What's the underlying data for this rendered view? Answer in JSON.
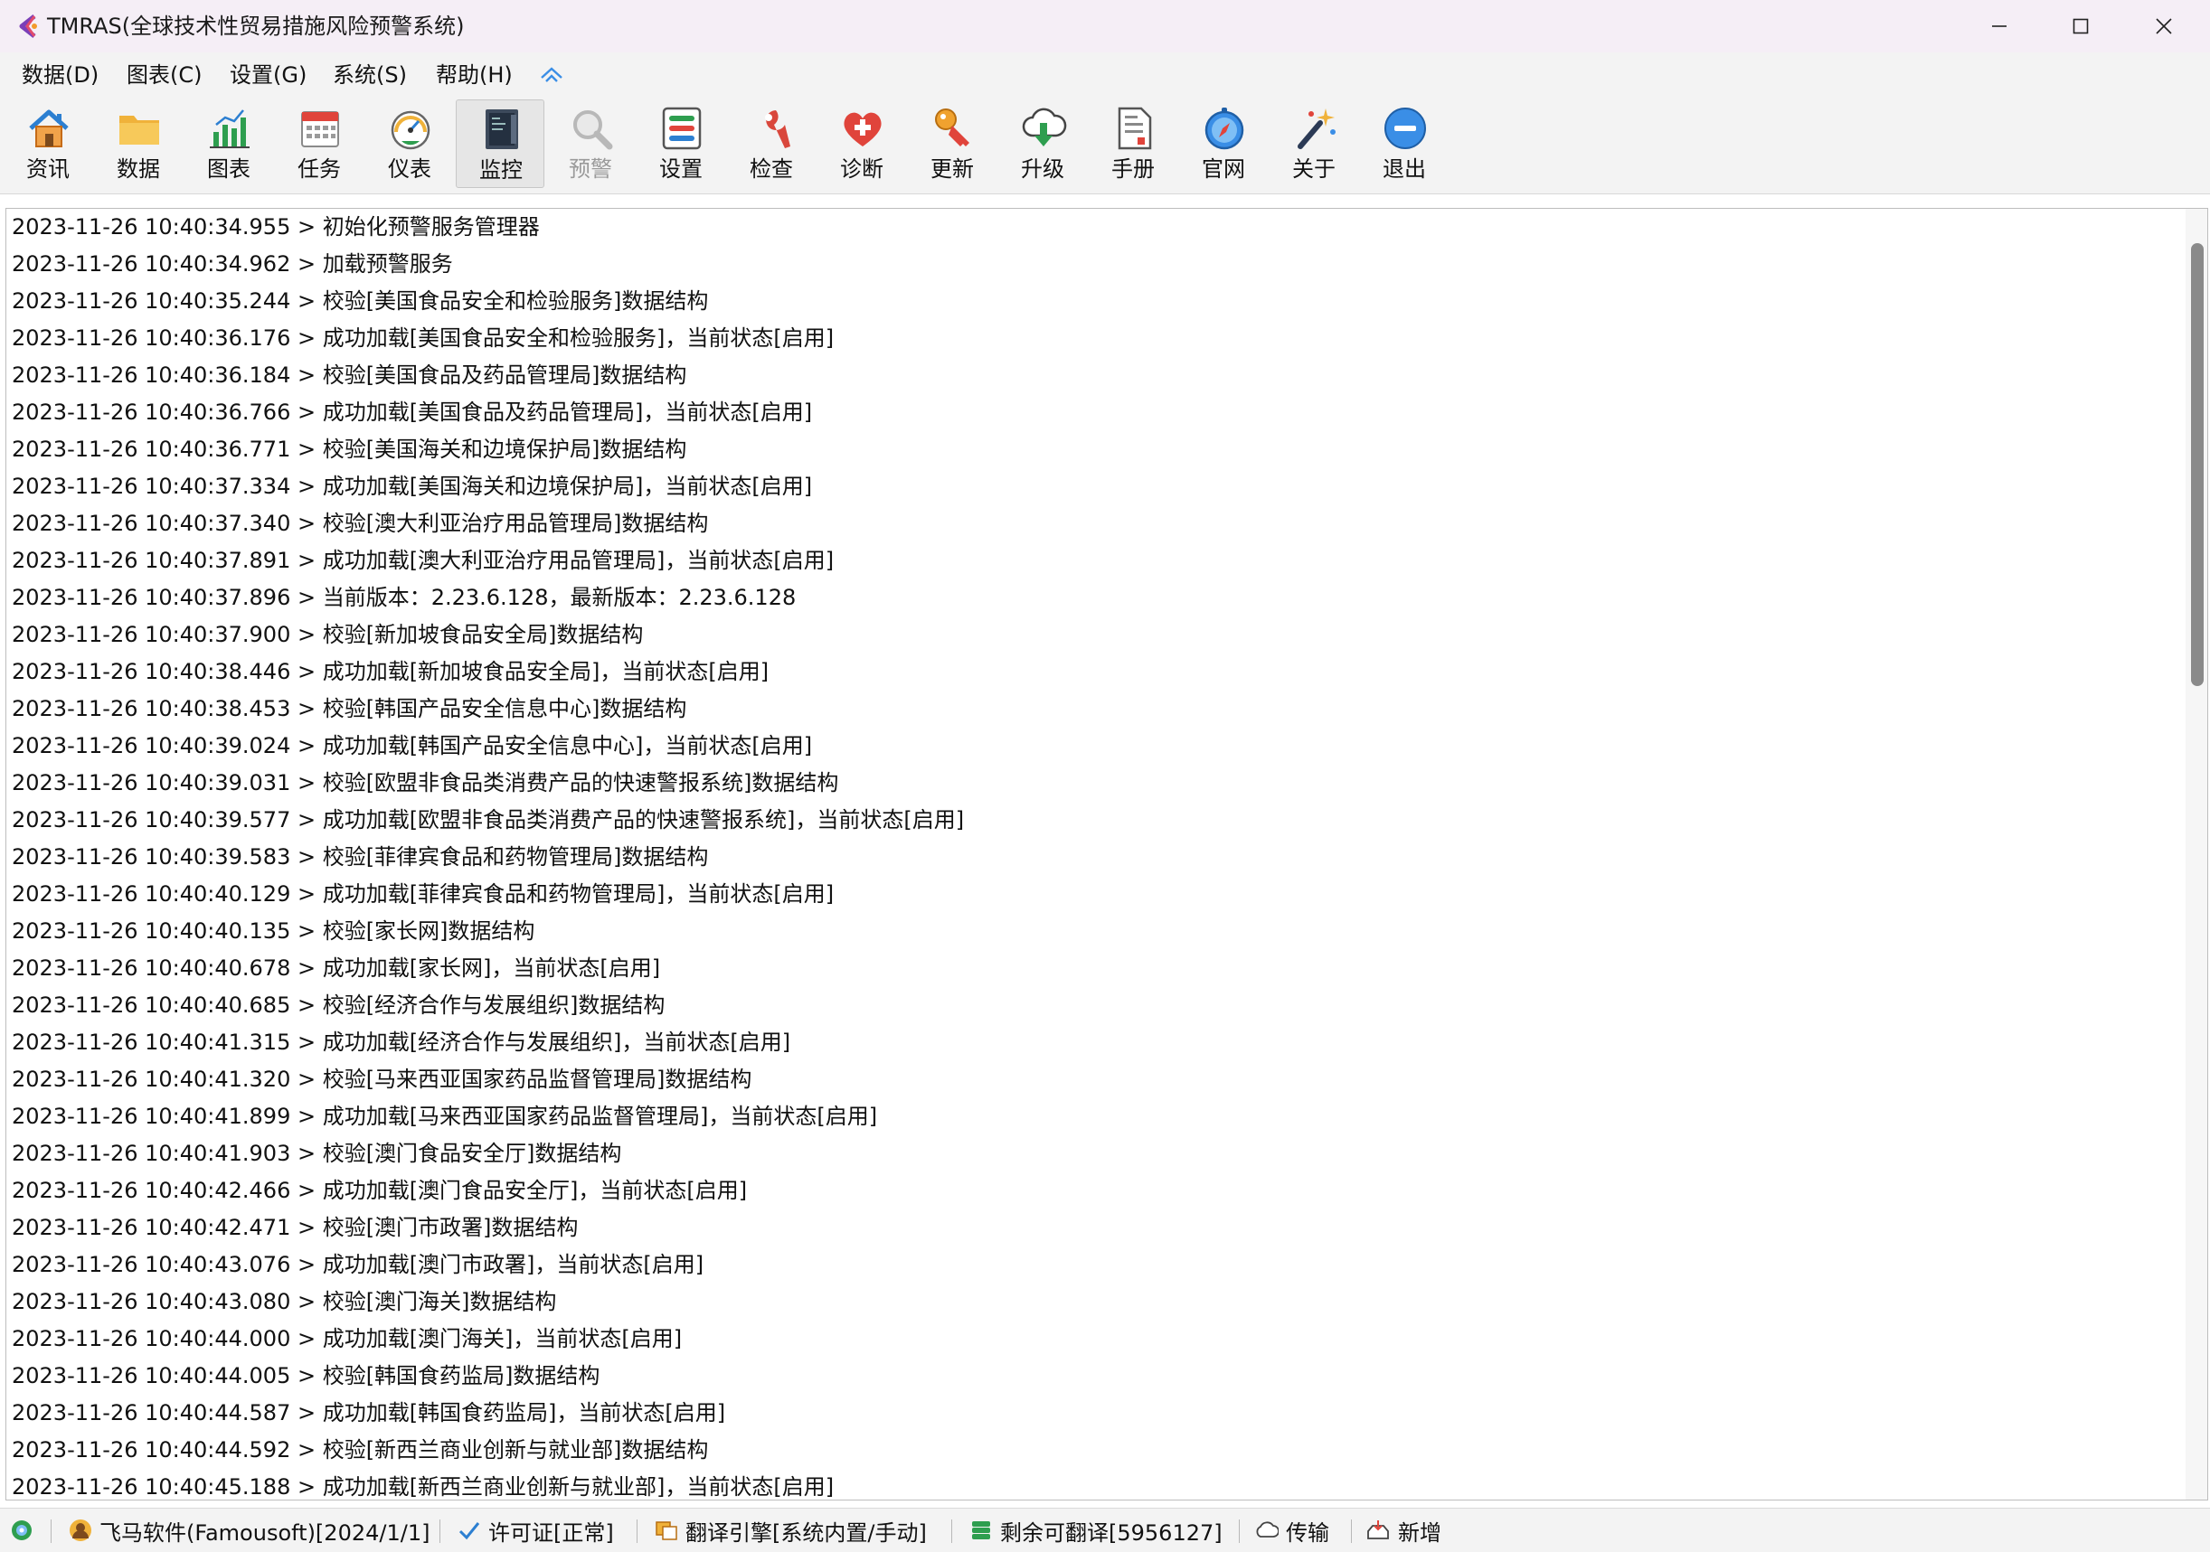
{
  "window": {
    "title": "TMRAS(全球技术性贸易措施风险预警系统)",
    "controls": {
      "minimize": "minimize",
      "maximize": "maximize",
      "close": "close"
    }
  },
  "menu": {
    "items": [
      {
        "label": "数据(D)"
      },
      {
        "label": "图表(C)"
      },
      {
        "label": "设置(G)"
      },
      {
        "label": "系统(S)"
      },
      {
        "label": "帮助(H)"
      }
    ]
  },
  "toolbar": {
    "buttons": [
      {
        "label": "资讯",
        "icon": "home-icon",
        "state": "normal"
      },
      {
        "label": "数据",
        "icon": "folder-icon",
        "state": "normal"
      },
      {
        "label": "图表",
        "icon": "bar-chart-icon",
        "state": "normal"
      },
      {
        "label": "任务",
        "icon": "calendar-icon",
        "state": "normal"
      },
      {
        "label": "仪表",
        "icon": "gauge-icon",
        "state": "normal"
      },
      {
        "label": "监控",
        "icon": "monitor-doc-icon",
        "state": "active"
      },
      {
        "label": "预警",
        "icon": "magnifier-icon",
        "state": "disabled"
      },
      {
        "label": "设置",
        "icon": "settings-sliders-icon",
        "state": "normal"
      },
      {
        "label": "检查",
        "icon": "wrench-icon",
        "state": "normal"
      },
      {
        "label": "诊断",
        "icon": "heart-plus-icon",
        "state": "normal"
      },
      {
        "label": "更新",
        "icon": "key-icon",
        "state": "normal"
      },
      {
        "label": "升级",
        "icon": "cloud-download-icon",
        "state": "normal"
      },
      {
        "label": "手册",
        "icon": "manual-doc-icon",
        "state": "normal"
      },
      {
        "label": "官网",
        "icon": "compass-icon",
        "state": "normal"
      },
      {
        "label": "关于",
        "icon": "magic-wand-icon",
        "state": "normal"
      },
      {
        "label": "退出",
        "icon": "exit-minus-icon",
        "state": "normal"
      }
    ]
  },
  "log": {
    "lines": [
      "2023-11-26 10:40:34.955 > 初始化预警服务管理器",
      "2023-11-26 10:40:34.962 > 加载预警服务",
      "2023-11-26 10:40:35.244 > 校验[美国食品安全和检验服务]数据结构",
      "2023-11-26 10:40:36.176 > 成功加载[美国食品安全和检验服务]，当前状态[启用]",
      "2023-11-26 10:40:36.184 > 校验[美国食品及药品管理局]数据结构",
      "2023-11-26 10:40:36.766 > 成功加载[美国食品及药品管理局]，当前状态[启用]",
      "2023-11-26 10:40:36.771 > 校验[美国海关和边境保护局]数据结构",
      "2023-11-26 10:40:37.334 > 成功加载[美国海关和边境保护局]，当前状态[启用]",
      "2023-11-26 10:40:37.340 > 校验[澳大利亚治疗用品管理局]数据结构",
      "2023-11-26 10:40:37.891 > 成功加载[澳大利亚治疗用品管理局]，当前状态[启用]",
      "2023-11-26 10:40:37.896 > 当前版本：2.23.6.128，最新版本：2.23.6.128",
      "2023-11-26 10:40:37.900 > 校验[新加坡食品安全局]数据结构",
      "2023-11-26 10:40:38.446 > 成功加载[新加坡食品安全局]，当前状态[启用]",
      "2023-11-26 10:40:38.453 > 校验[韩国产品安全信息中心]数据结构",
      "2023-11-26 10:40:39.024 > 成功加载[韩国产品安全信息中心]，当前状态[启用]",
      "2023-11-26 10:40:39.031 > 校验[欧盟非食品类消费产品的快速警报系统]数据结构",
      "2023-11-26 10:40:39.577 > 成功加载[欧盟非食品类消费产品的快速警报系统]，当前状态[启用]",
      "2023-11-26 10:40:39.583 > 校验[菲律宾食品和药物管理局]数据结构",
      "2023-11-26 10:40:40.129 > 成功加载[菲律宾食品和药物管理局]，当前状态[启用]",
      "2023-11-26 10:40:40.135 > 校验[家长网]数据结构",
      "2023-11-26 10:40:40.678 > 成功加载[家长网]，当前状态[启用]",
      "2023-11-26 10:40:40.685 > 校验[经济合作与发展组织]数据结构",
      "2023-11-26 10:40:41.315 > 成功加载[经济合作与发展组织]，当前状态[启用]",
      "2023-11-26 10:40:41.320 > 校验[马来西亚国家药品监督管理局]数据结构",
      "2023-11-26 10:40:41.899 > 成功加载[马来西亚国家药品监督管理局]，当前状态[启用]",
      "2023-11-26 10:40:41.903 > 校验[澳门食品安全厅]数据结构",
      "2023-11-26 10:40:42.466 > 成功加载[澳门食品安全厅]，当前状态[启用]",
      "2023-11-26 10:40:42.471 > 校验[澳门市政署]数据结构",
      "2023-11-26 10:40:43.076 > 成功加载[澳门市政署]，当前状态[启用]",
      "2023-11-26 10:40:43.080 > 校验[澳门海关]数据结构",
      "2023-11-26 10:40:44.000 > 成功加载[澳门海关]，当前状态[启用]",
      "2023-11-26 10:40:44.005 > 校验[韩国食药监局]数据结构",
      "2023-11-26 10:40:44.587 > 成功加载[韩国食药监局]，当前状态[启用]",
      "2023-11-26 10:40:44.592 > 校验[新西兰商业创新与就业部]数据结构",
      "2023-11-26 10:40:45.188 > 成功加载[新西兰商业创新与就业部]，当前状态[启用]"
    ]
  },
  "statusbar": {
    "company": "飞马软件(Famousoft)[2024/1/1]",
    "license": "许可证[正常]",
    "engine": "翻译引擎[系统内置/手动]",
    "quota": "剩余可翻译[5956127]",
    "transfer": "传输",
    "add": "新增"
  },
  "colors": {
    "titlebar_bg": "#f5eef6",
    "chrome_bg": "#f3f3f3",
    "log_bg": "#ffffff",
    "scroll_thumb": "#8a8a8a",
    "accent_blue": "#3a8ee6"
  }
}
